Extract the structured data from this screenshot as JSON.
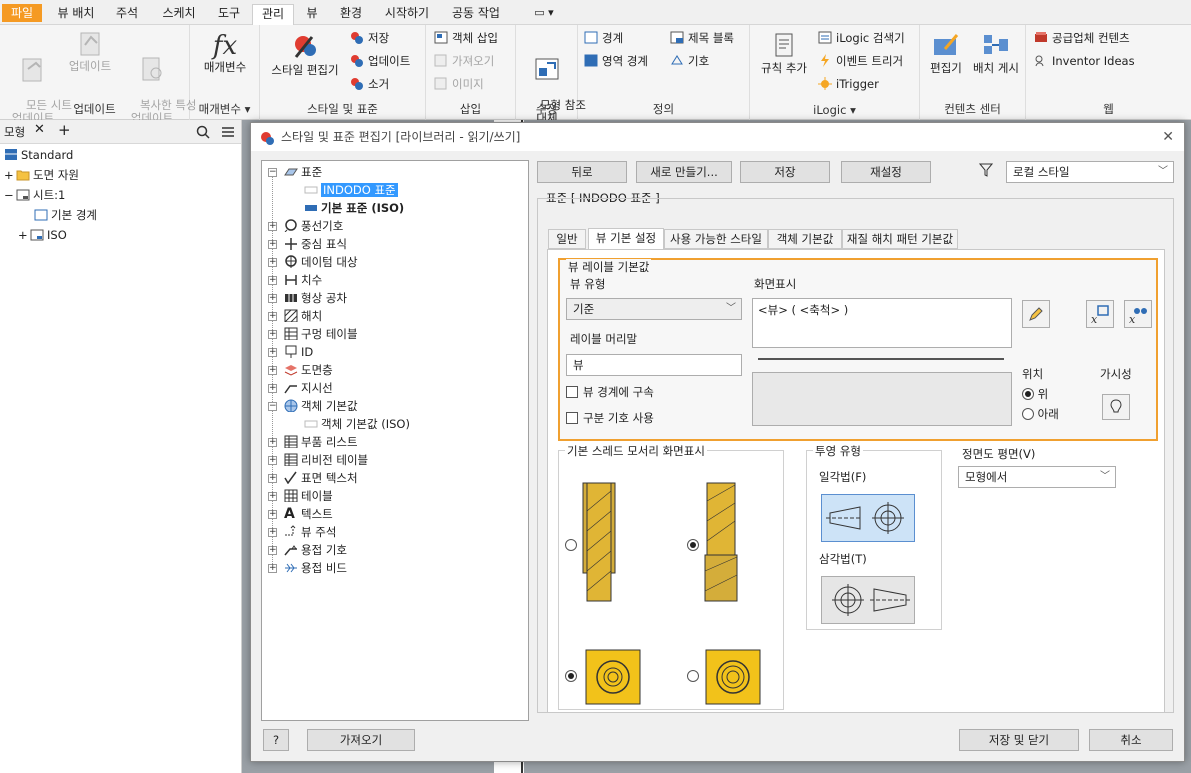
{
  "menubar": {
    "tabs": [
      "파일",
      "뷰 배치",
      "주석",
      "스케치",
      "도구",
      "관리",
      "뷰",
      "환경",
      "시작하기",
      "공동 작업"
    ],
    "extra": "▭ ▾"
  },
  "ribbon": {
    "update": {
      "title": "업데이트",
      "all_sheets": "모든 시트\n업데이트",
      "update": "업데이트",
      "copy_props": "복사한 특성\n업데이트"
    },
    "params": {
      "title": "매개변수 ▾",
      "label": "매개변수"
    },
    "styles": {
      "title": "스타일 및 표준",
      "editor": "스타일 편집기",
      "save": "저장",
      "update": "업데이트",
      "purge": "소거"
    },
    "insert": {
      "title": "삽입",
      "object": "객체 삽입",
      "import": "가져오기",
      "image": "이미지"
    },
    "modify": {
      "title": "수정",
      "replace": "모형 참조\n대체"
    },
    "define": {
      "title": "정의",
      "border": "경계",
      "zone_border": "영역 경계",
      "title_block": "제목 블록",
      "symbol": "기호"
    },
    "ilogic": {
      "title": "iLogic ▾",
      "rule": "규칙 추가",
      "browser": "iLogic 검색기",
      "trigger": "이벤트 트리거",
      "itrigger": "iTrigger"
    },
    "content": {
      "title": "컨텐츠 센터",
      "editor": "편집기",
      "publish": "배치 게시"
    },
    "web": {
      "title": "웹",
      "supplier": "공급업체 컨텐츠",
      "ideas": "Inventor Ideas"
    }
  },
  "browser": {
    "tab": "모형",
    "items": [
      "Standard",
      "도면 자원",
      "시트:1",
      "기본 경계",
      "ISO"
    ]
  },
  "dialog": {
    "title": "스타일 및 표준 편집기 [라이브러리 - 읽기/쓰기]",
    "tree": {
      "root": "표준",
      "selected": "INDODO 표준",
      "default": "기본 표준 (ISO)",
      "items": [
        "풍선기호",
        "중심 표식",
        "데이텀 대상",
        "치수",
        "형상 공차",
        "해치",
        "구멍 테이블",
        "ID",
        "도면층",
        "지시선",
        "객체 기본값",
        "객체 기본값 (ISO)",
        "부품 리스트",
        "리비전 테이블",
        "표면 텍스처",
        "테이블",
        "텍스트",
        "뷰 주석",
        "용접 기호",
        "용접 비드"
      ]
    },
    "buttons": {
      "back": "뒤로",
      "new": "새로 만들기...",
      "save": "저장",
      "reset": "재설정",
      "import": "가져오기",
      "save_close": "저장 및 닫기",
      "cancel": "취소"
    },
    "filter": "로컬 스타일",
    "header": "표준 [ INDODO 표준 ]",
    "tabs": [
      "일반",
      "뷰 기본 설정",
      "사용 가능한 스타일",
      "객체 기본값",
      "재질 해치 패턴 기본값"
    ],
    "view_label": {
      "group": "뷰 레이블 기본값",
      "view_type_label": "뷰 유형",
      "view_type_value": "기준",
      "display_label": "화면표시",
      "display_value": "<뷰> ( <축척> )",
      "prefix_label": "레이블 머리말",
      "prefix_value": "뷰",
      "constrain": "뷰 경계에 구속",
      "use_delimiter": "구분 기호 사용",
      "position_label": "위치",
      "pos_above": "위",
      "pos_below": "아래",
      "visibility_label": "가시성"
    },
    "thread": {
      "label": "기본 스레드 모서리 화면표시"
    },
    "projection": {
      "label": "투영 유형",
      "first": "일각법(F)",
      "third": "삼각법(T)"
    },
    "front": {
      "label": "정면도 평면(V)",
      "value": "모형에서"
    }
  }
}
